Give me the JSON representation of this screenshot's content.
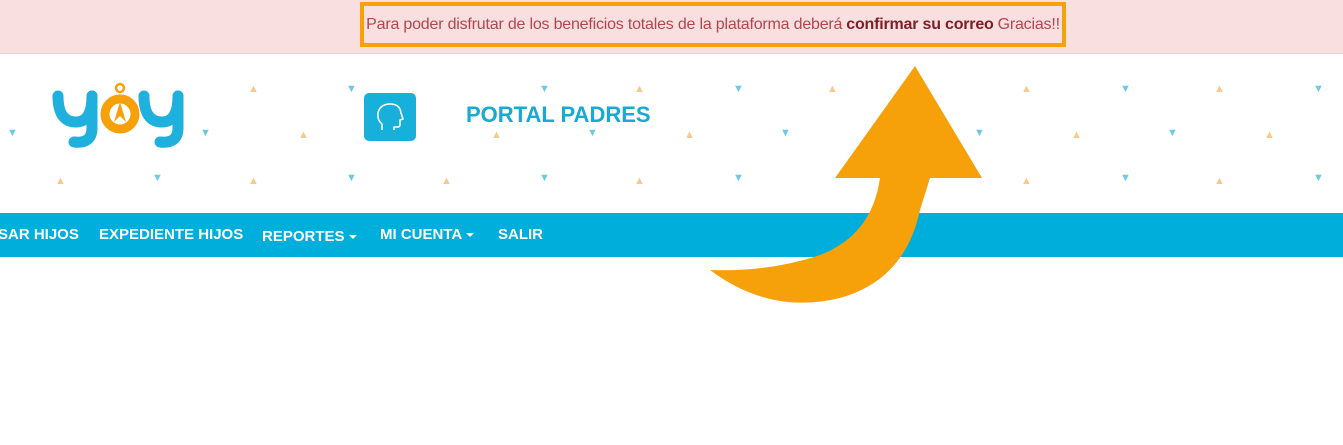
{
  "alert": {
    "text_before": "Para poder disfrutar de los beneficios totales de la plataforma deberá",
    "link_text": "confirmar su correo",
    "text_after": "Gracias!!"
  },
  "header": {
    "logo_text": "yoy",
    "title": "PORTAL PADRES",
    "icon": "head-profile-icon"
  },
  "nav": {
    "items": [
      {
        "label": "SAR HIJOS",
        "has_caret": false
      },
      {
        "label": "EXPEDIENTE HIJOS",
        "has_caret": false
      },
      {
        "label": "REPORTES",
        "has_caret": true
      },
      {
        "label": "MI CUENTA",
        "has_caret": true
      },
      {
        "label": "SALIR",
        "has_caret": false
      }
    ]
  },
  "colors": {
    "alert_bg": "#f9dfe0",
    "highlight": "#f7a10a",
    "nav_bg": "#00aedb",
    "brand_blue": "#18a9d6"
  }
}
